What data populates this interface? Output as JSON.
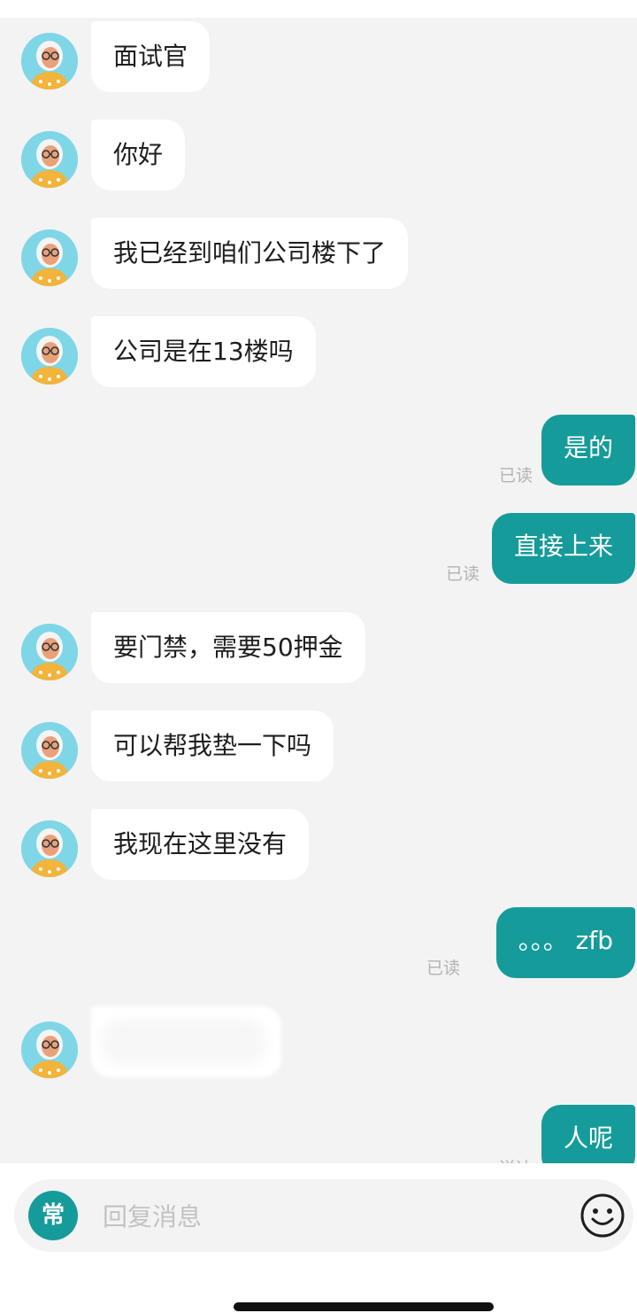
{
  "messages": [
    {
      "side": "in",
      "text": "面试官"
    },
    {
      "side": "in",
      "text": "你好"
    },
    {
      "side": "in",
      "text": "我已经到咱们公司楼下了"
    },
    {
      "side": "in",
      "text": "公司是在13楼吗"
    },
    {
      "side": "out",
      "text": "是的",
      "status": "已读"
    },
    {
      "side": "out",
      "text": "直接上来",
      "status": "已读"
    },
    {
      "side": "in",
      "text": "要门禁，需要50押金"
    },
    {
      "side": "in",
      "text": "可以帮我垫一下吗"
    },
    {
      "side": "in",
      "text": "我现在这里没有"
    },
    {
      "side": "out",
      "text": "。。。 zfb",
      "status": "已读"
    },
    {
      "side": "in",
      "text": "",
      "blurred": true
    },
    {
      "side": "out",
      "text": "人呢",
      "status": "送达"
    }
  ],
  "input": {
    "common_phrases_label": "常",
    "placeholder": "回复消息",
    "emoji_icon": "smiley-face-icon"
  },
  "colors": {
    "accent": "#169b9b",
    "incoming_bubble": "#ffffff",
    "background": "#f3f3f3",
    "avatar_bg": "#7fd6e6"
  }
}
